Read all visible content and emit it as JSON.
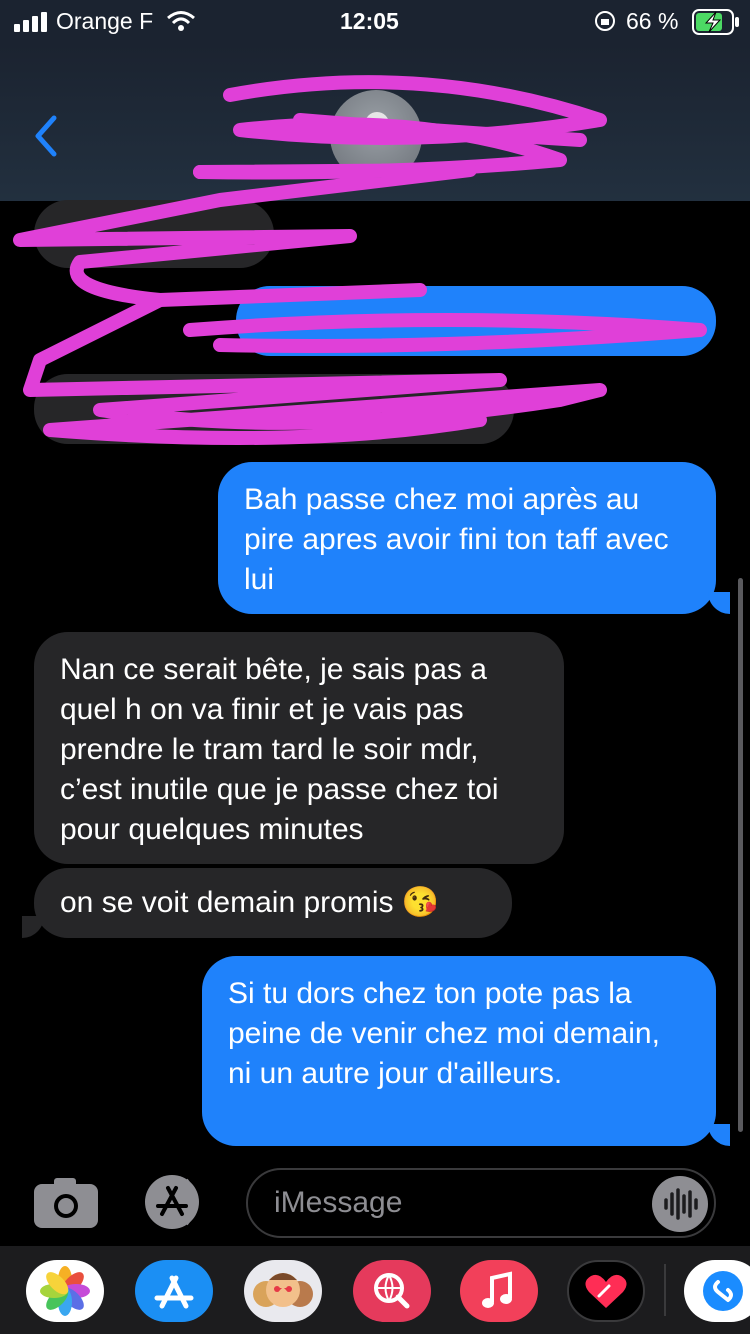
{
  "status_bar": {
    "carrier": "Orange F",
    "time": "12:05",
    "battery": "66 %"
  },
  "messages": [
    {
      "from": "me",
      "text": "Bah passe chez moi après au pire apres avoir fini ton taff avec lui"
    },
    {
      "from": "them",
      "text": "Nan ce serait bête, je sais pas a quel h on va finir et je vais pas prendre le tram tard le soir mdr, c’est inutile que je passe chez toi pour quelques minutes"
    },
    {
      "from": "them",
      "text": "on se voit demain promis 😘"
    },
    {
      "from": "me",
      "text": "Si tu dors chez ton pote pas la peine de venir chez moi demain, ni un autre jour d'ailleurs."
    }
  ],
  "composer": {
    "placeholder": "iMessage",
    "icons": [
      "camera-icon",
      "app-store-icon",
      "audio-waveform-icon"
    ]
  },
  "app_drawer": [
    "photos",
    "app-store",
    "memoji",
    "search-web",
    "music",
    "digital-touch",
    "shazam"
  ],
  "colors": {
    "sent_bubble": "#1f82fb",
    "received_bubble": "#262628",
    "scribble": "#e040d8",
    "accent_blue": "#1f82fb"
  }
}
